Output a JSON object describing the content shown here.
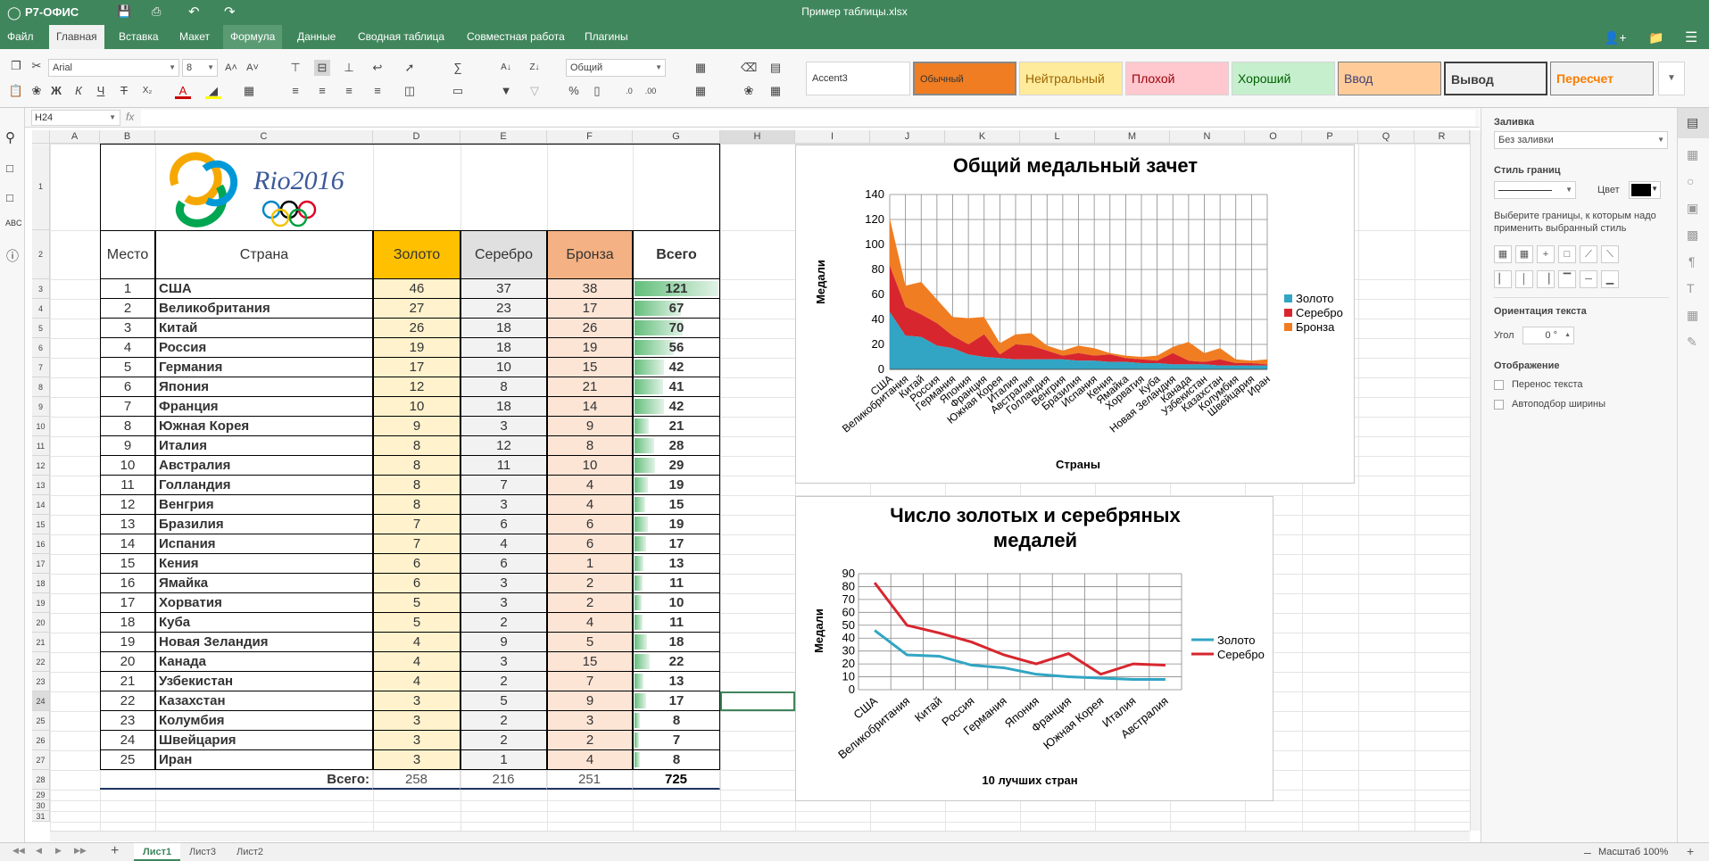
{
  "app": {
    "brand": "Р7-ОФИС",
    "doc_title": "Пример таблицы.xlsx",
    "accent": "#40865c"
  },
  "menu": {
    "items": [
      "Файл",
      "Главная",
      "Вставка",
      "Макет",
      "Формула",
      "Данные",
      "Сводная таблица",
      "Совместная работа",
      "Плагины"
    ]
  },
  "toolbar": {
    "font_name": "Arial",
    "font_size": "8",
    "number_format": "Общий"
  },
  "styles": [
    {
      "label": "Accent3",
      "bg": "#ffffff",
      "fg": "#000000"
    },
    {
      "label": "Обычный",
      "bg": "#f07d22",
      "fg": "#000000"
    },
    {
      "label": "Нейтральный",
      "bg": "#ffeb9c",
      "fg": "#9c6500"
    },
    {
      "label": "Плохой",
      "bg": "#ffc7ce",
      "fg": "#9c0006"
    },
    {
      "label": "Хороший",
      "bg": "#c6efce",
      "fg": "#006100"
    },
    {
      "label": "Ввод",
      "bg": "#ffcc99",
      "fg": "#3f3f76"
    },
    {
      "label": "Вывод",
      "bg": "#f2f2f2",
      "fg": "#3f3f3f"
    },
    {
      "label": "Пересчет",
      "bg": "#f2f2f2",
      "fg": "#fa7d00"
    }
  ],
  "formula": {
    "cell_ref": "H24",
    "fx": "fx"
  },
  "columns": [
    "A",
    "B",
    "C",
    "D",
    "E",
    "F",
    "G",
    "H",
    "I",
    "J",
    "K",
    "L",
    "M",
    "N",
    "O",
    "P",
    "Q",
    "R"
  ],
  "rows": [
    "1",
    "2",
    "3",
    "4",
    "5",
    "6",
    "7",
    "8",
    "9",
    "10",
    "11",
    "12",
    "13",
    "14",
    "15",
    "16",
    "17",
    "18",
    "19",
    "20",
    "21",
    "22",
    "23",
    "24",
    "25",
    "26",
    "27",
    "28",
    "29",
    "30",
    "31"
  ],
  "table": {
    "headers": [
      "Место",
      "Страна",
      "Золото",
      "Серебро",
      "Бронза",
      "Всего"
    ],
    "header_colors": [
      "#ffffff",
      "#ffffff",
      "#ffc000",
      "#e0e0e0",
      "#f4b183",
      "#ffffff"
    ],
    "data": [
      [
        "1",
        "США",
        "46",
        "37",
        "38",
        "121"
      ],
      [
        "2",
        "Великобритания",
        "27",
        "23",
        "17",
        "67"
      ],
      [
        "3",
        "Китай",
        "26",
        "18",
        "26",
        "70"
      ],
      [
        "4",
        "Россия",
        "19",
        "18",
        "19",
        "56"
      ],
      [
        "5",
        "Германия",
        "17",
        "10",
        "15",
        "42"
      ],
      [
        "6",
        "Япония",
        "12",
        "8",
        "21",
        "41"
      ],
      [
        "7",
        "Франция",
        "10",
        "18",
        "14",
        "42"
      ],
      [
        "8",
        "Южная Корея",
        "9",
        "3",
        "9",
        "21"
      ],
      [
        "9",
        "Италия",
        "8",
        "12",
        "8",
        "28"
      ],
      [
        "10",
        "Австралия",
        "8",
        "11",
        "10",
        "29"
      ],
      [
        "11",
        "Голландия",
        "8",
        "7",
        "4",
        "19"
      ],
      [
        "12",
        "Венгрия",
        "8",
        "3",
        "4",
        "15"
      ],
      [
        "13",
        "Бразилия",
        "7",
        "6",
        "6",
        "19"
      ],
      [
        "14",
        "Испания",
        "7",
        "4",
        "6",
        "17"
      ],
      [
        "15",
        "Кения",
        "6",
        "6",
        "1",
        "13"
      ],
      [
        "16",
        "Ямайка",
        "6",
        "3",
        "2",
        "11"
      ],
      [
        "17",
        "Хорватия",
        "5",
        "3",
        "2",
        "10"
      ],
      [
        "18",
        "Куба",
        "5",
        "2",
        "4",
        "11"
      ],
      [
        "19",
        "Новая Зеландия",
        "4",
        "9",
        "5",
        "18"
      ],
      [
        "20",
        "Канада",
        "4",
        "3",
        "15",
        "22"
      ],
      [
        "21",
        "Узбекистан",
        "4",
        "2",
        "7",
        "13"
      ],
      [
        "22",
        "Казахстан",
        "3",
        "5",
        "9",
        "17"
      ],
      [
        "23",
        "Колумбия",
        "3",
        "2",
        "3",
        "8"
      ],
      [
        "24",
        "Швейцария",
        "3",
        "2",
        "2",
        "7"
      ],
      [
        "25",
        "Иран",
        "3",
        "1",
        "4",
        "8"
      ]
    ],
    "total_label": "Всего:",
    "totals": [
      "258",
      "216",
      "251",
      "725"
    ],
    "logo_text": "Rio2016"
  },
  "chart_data": [
    {
      "type": "area",
      "title": "Общий медальный зачет",
      "xlabel": "Страны",
      "ylabel": "Медали",
      "ylim": [
        0,
        140
      ],
      "yticks": [
        "0",
        "20",
        "40",
        "60",
        "80",
        "100",
        "120",
        "140"
      ],
      "categories": [
        "США",
        "Великобритания",
        "Китай",
        "Россия",
        "Германия",
        "Япония",
        "Франция",
        "Южная Корея",
        "Италия",
        "Австралия",
        "Голландия",
        "Венгрия",
        "Бразилия",
        "Испания",
        "Кения",
        "Ямайка",
        "Хорватия",
        "Куба",
        "Новая Зеландия",
        "Канада",
        "Узбекистан",
        "Казахстан",
        "Колумбия",
        "Швейцария",
        "Иран"
      ],
      "series": [
        {
          "name": "Золото",
          "color": "#31a5c3",
          "values": [
            46,
            27,
            26,
            19,
            17,
            12,
            10,
            9,
            8,
            8,
            8,
            8,
            7,
            7,
            6,
            6,
            5,
            5,
            4,
            4,
            4,
            3,
            3,
            3,
            3
          ]
        },
        {
          "name": "Серебро",
          "color": "#d7262e",
          "values": [
            37,
            23,
            18,
            18,
            10,
            8,
            18,
            3,
            12,
            11,
            7,
            3,
            6,
            4,
            6,
            3,
            3,
            2,
            9,
            3,
            2,
            5,
            2,
            2,
            1
          ]
        },
        {
          "name": "Бронза",
          "color": "#f07d22",
          "values": [
            38,
            17,
            26,
            19,
            15,
            21,
            14,
            9,
            8,
            10,
            4,
            4,
            6,
            6,
            1,
            2,
            2,
            4,
            5,
            15,
            7,
            9,
            3,
            2,
            4
          ]
        }
      ],
      "legend": "right"
    },
    {
      "type": "line",
      "title": "Число золотых и серебряных медалей",
      "title_lines": [
        "Число золотых и серебряных",
        "медалей"
      ],
      "xlabel": "10 лучших стран",
      "ylabel": "Медали",
      "ylim": [
        0,
        90
      ],
      "yticks": [
        "0",
        "10",
        "20",
        "30",
        "40",
        "50",
        "60",
        "70",
        "80",
        "90"
      ],
      "categories": [
        "США",
        "Великобритания",
        "Китай",
        "Россия",
        "Германия",
        "Япония",
        "Франция",
        "Южная Корея",
        "Италия",
        "Австралия"
      ],
      "series": [
        {
          "name": "Золото",
          "color": "#31a5c3",
          "values": [
            46,
            27,
            26,
            19,
            17,
            12,
            10,
            9,
            8,
            8
          ]
        },
        {
          "name": "Серебро",
          "color": "#d7262e",
          "values": [
            83,
            50,
            44,
            37,
            27,
            20,
            28,
            12,
            20,
            19
          ]
        }
      ],
      "legend": "right"
    }
  ],
  "right_panel": {
    "fill_title": "Заливка",
    "fill_value": "Без заливки",
    "border_style_title": "Стиль границ",
    "color_label": "Цвет",
    "border_hint": "Выберите границы, к которым надо применить выбранный стиль",
    "orient_title": "Ориентация текста",
    "angle_label": "Угол",
    "angle_value": "0 °",
    "display_title": "Отображение",
    "wrap_label": "Перенос текста",
    "autofit_label": "Автоподбор ширины"
  },
  "tabs": [
    "Лист1",
    "Лист3",
    "Лист2"
  ],
  "status": {
    "zoom": "Масштаб 100%"
  }
}
